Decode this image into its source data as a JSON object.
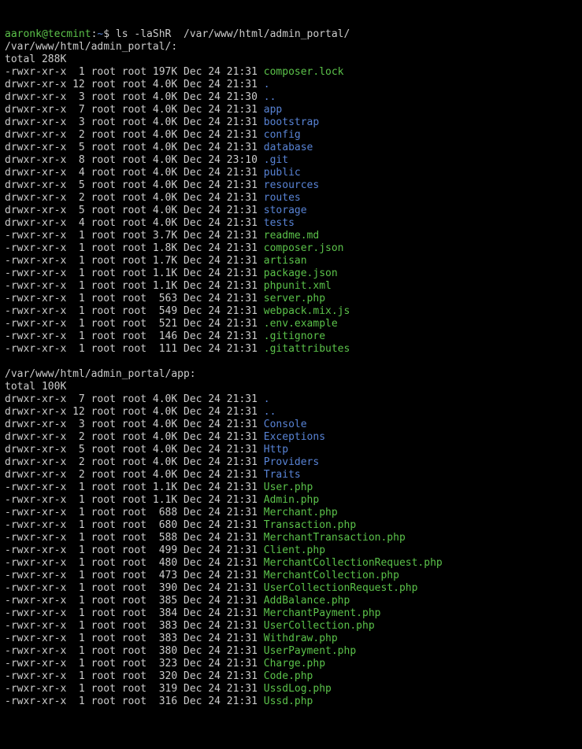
{
  "prompt": {
    "user": "aaronk",
    "host": "tecmint",
    "path": "~",
    "symbol": "$",
    "command": "ls -laShR  /var/www/html/admin_portal/"
  },
  "sections": [
    {
      "header": "/var/www/html/admin_portal/:",
      "total": "total 288K",
      "rows": [
        {
          "perm": "-rwxr-xr-x",
          "links": " 1",
          "owner": "root",
          "group": "root",
          "size": "197K",
          "date": "Dec 24 21:31",
          "name": "composer.lock",
          "cls": "file-exec"
        },
        {
          "perm": "drwxr-xr-x",
          "links": "12",
          "owner": "root",
          "group": "root",
          "size": "4.0K",
          "date": "Dec 24 21:31",
          "name": ".",
          "cls": "file-dir"
        },
        {
          "perm": "drwxr-xr-x",
          "links": " 3",
          "owner": "root",
          "group": "root",
          "size": "4.0K",
          "date": "Dec 24 21:30",
          "name": "..",
          "cls": "file-dir"
        },
        {
          "perm": "drwxr-xr-x",
          "links": " 7",
          "owner": "root",
          "group": "root",
          "size": "4.0K",
          "date": "Dec 24 21:31",
          "name": "app",
          "cls": "file-dir"
        },
        {
          "perm": "drwxr-xr-x",
          "links": " 3",
          "owner": "root",
          "group": "root",
          "size": "4.0K",
          "date": "Dec 24 21:31",
          "name": "bootstrap",
          "cls": "file-dir"
        },
        {
          "perm": "drwxr-xr-x",
          "links": " 2",
          "owner": "root",
          "group": "root",
          "size": "4.0K",
          "date": "Dec 24 21:31",
          "name": "config",
          "cls": "file-dir"
        },
        {
          "perm": "drwxr-xr-x",
          "links": " 5",
          "owner": "root",
          "group": "root",
          "size": "4.0K",
          "date": "Dec 24 21:31",
          "name": "database",
          "cls": "file-dir"
        },
        {
          "perm": "drwxr-xr-x",
          "links": " 8",
          "owner": "root",
          "group": "root",
          "size": "4.0K",
          "date": "Dec 24 23:10",
          "name": ".git",
          "cls": "file-dir"
        },
        {
          "perm": "drwxr-xr-x",
          "links": " 4",
          "owner": "root",
          "group": "root",
          "size": "4.0K",
          "date": "Dec 24 21:31",
          "name": "public",
          "cls": "file-dir"
        },
        {
          "perm": "drwxr-xr-x",
          "links": " 5",
          "owner": "root",
          "group": "root",
          "size": "4.0K",
          "date": "Dec 24 21:31",
          "name": "resources",
          "cls": "file-dir"
        },
        {
          "perm": "drwxr-xr-x",
          "links": " 2",
          "owner": "root",
          "group": "root",
          "size": "4.0K",
          "date": "Dec 24 21:31",
          "name": "routes",
          "cls": "file-dir"
        },
        {
          "perm": "drwxr-xr-x",
          "links": " 5",
          "owner": "root",
          "group": "root",
          "size": "4.0K",
          "date": "Dec 24 21:31",
          "name": "storage",
          "cls": "file-dir"
        },
        {
          "perm": "drwxr-xr-x",
          "links": " 4",
          "owner": "root",
          "group": "root",
          "size": "4.0K",
          "date": "Dec 24 21:31",
          "name": "tests",
          "cls": "file-dir"
        },
        {
          "perm": "-rwxr-xr-x",
          "links": " 1",
          "owner": "root",
          "group": "root",
          "size": "3.7K",
          "date": "Dec 24 21:31",
          "name": "readme.md",
          "cls": "file-exec"
        },
        {
          "perm": "-rwxr-xr-x",
          "links": " 1",
          "owner": "root",
          "group": "root",
          "size": "1.8K",
          "date": "Dec 24 21:31",
          "name": "composer.json",
          "cls": "file-exec"
        },
        {
          "perm": "-rwxr-xr-x",
          "links": " 1",
          "owner": "root",
          "group": "root",
          "size": "1.7K",
          "date": "Dec 24 21:31",
          "name": "artisan",
          "cls": "file-exec"
        },
        {
          "perm": "-rwxr-xr-x",
          "links": " 1",
          "owner": "root",
          "group": "root",
          "size": "1.1K",
          "date": "Dec 24 21:31",
          "name": "package.json",
          "cls": "file-exec"
        },
        {
          "perm": "-rwxr-xr-x",
          "links": " 1",
          "owner": "root",
          "group": "root",
          "size": "1.1K",
          "date": "Dec 24 21:31",
          "name": "phpunit.xml",
          "cls": "file-exec"
        },
        {
          "perm": "-rwxr-xr-x",
          "links": " 1",
          "owner": "root",
          "group": "root",
          "size": " 563",
          "date": "Dec 24 21:31",
          "name": "server.php",
          "cls": "file-exec"
        },
        {
          "perm": "-rwxr-xr-x",
          "links": " 1",
          "owner": "root",
          "group": "root",
          "size": " 549",
          "date": "Dec 24 21:31",
          "name": "webpack.mix.js",
          "cls": "file-exec"
        },
        {
          "perm": "-rwxr-xr-x",
          "links": " 1",
          "owner": "root",
          "group": "root",
          "size": " 521",
          "date": "Dec 24 21:31",
          "name": ".env.example",
          "cls": "file-exec"
        },
        {
          "perm": "-rwxr-xr-x",
          "links": " 1",
          "owner": "root",
          "group": "root",
          "size": " 146",
          "date": "Dec 24 21:31",
          "name": ".gitignore",
          "cls": "file-exec"
        },
        {
          "perm": "-rwxr-xr-x",
          "links": " 1",
          "owner": "root",
          "group": "root",
          "size": " 111",
          "date": "Dec 24 21:31",
          "name": ".gitattributes",
          "cls": "file-exec"
        }
      ]
    },
    {
      "header": "/var/www/html/admin_portal/app:",
      "total": "total 100K",
      "rows": [
        {
          "perm": "drwxr-xr-x",
          "links": " 7",
          "owner": "root",
          "group": "root",
          "size": "4.0K",
          "date": "Dec 24 21:31",
          "name": ".",
          "cls": "file-dir"
        },
        {
          "perm": "drwxr-xr-x",
          "links": "12",
          "owner": "root",
          "group": "root",
          "size": "4.0K",
          "date": "Dec 24 21:31",
          "name": "..",
          "cls": "file-dir"
        },
        {
          "perm": "drwxr-xr-x",
          "links": " 3",
          "owner": "root",
          "group": "root",
          "size": "4.0K",
          "date": "Dec 24 21:31",
          "name": "Console",
          "cls": "file-dir"
        },
        {
          "perm": "drwxr-xr-x",
          "links": " 2",
          "owner": "root",
          "group": "root",
          "size": "4.0K",
          "date": "Dec 24 21:31",
          "name": "Exceptions",
          "cls": "file-dir"
        },
        {
          "perm": "drwxr-xr-x",
          "links": " 5",
          "owner": "root",
          "group": "root",
          "size": "4.0K",
          "date": "Dec 24 21:31",
          "name": "Http",
          "cls": "file-dir"
        },
        {
          "perm": "drwxr-xr-x",
          "links": " 2",
          "owner": "root",
          "group": "root",
          "size": "4.0K",
          "date": "Dec 24 21:31",
          "name": "Providers",
          "cls": "file-dir"
        },
        {
          "perm": "drwxr-xr-x",
          "links": " 2",
          "owner": "root",
          "group": "root",
          "size": "4.0K",
          "date": "Dec 24 21:31",
          "name": "Traits",
          "cls": "file-dir"
        },
        {
          "perm": "-rwxr-xr-x",
          "links": " 1",
          "owner": "root",
          "group": "root",
          "size": "1.1K",
          "date": "Dec 24 21:31",
          "name": "User.php",
          "cls": "file-exec"
        },
        {
          "perm": "-rwxr-xr-x",
          "links": " 1",
          "owner": "root",
          "group": "root",
          "size": "1.1K",
          "date": "Dec 24 21:31",
          "name": "Admin.php",
          "cls": "file-exec"
        },
        {
          "perm": "-rwxr-xr-x",
          "links": " 1",
          "owner": "root",
          "group": "root",
          "size": " 688",
          "date": "Dec 24 21:31",
          "name": "Merchant.php",
          "cls": "file-exec"
        },
        {
          "perm": "-rwxr-xr-x",
          "links": " 1",
          "owner": "root",
          "group": "root",
          "size": " 680",
          "date": "Dec 24 21:31",
          "name": "Transaction.php",
          "cls": "file-exec"
        },
        {
          "perm": "-rwxr-xr-x",
          "links": " 1",
          "owner": "root",
          "group": "root",
          "size": " 588",
          "date": "Dec 24 21:31",
          "name": "MerchantTransaction.php",
          "cls": "file-exec"
        },
        {
          "perm": "-rwxr-xr-x",
          "links": " 1",
          "owner": "root",
          "group": "root",
          "size": " 499",
          "date": "Dec 24 21:31",
          "name": "Client.php",
          "cls": "file-exec"
        },
        {
          "perm": "-rwxr-xr-x",
          "links": " 1",
          "owner": "root",
          "group": "root",
          "size": " 480",
          "date": "Dec 24 21:31",
          "name": "MerchantCollectionRequest.php",
          "cls": "file-exec"
        },
        {
          "perm": "-rwxr-xr-x",
          "links": " 1",
          "owner": "root",
          "group": "root",
          "size": " 473",
          "date": "Dec 24 21:31",
          "name": "MerchantCollection.php",
          "cls": "file-exec"
        },
        {
          "perm": "-rwxr-xr-x",
          "links": " 1",
          "owner": "root",
          "group": "root",
          "size": " 390",
          "date": "Dec 24 21:31",
          "name": "UserCollectionRequest.php",
          "cls": "file-exec"
        },
        {
          "perm": "-rwxr-xr-x",
          "links": " 1",
          "owner": "root",
          "group": "root",
          "size": " 385",
          "date": "Dec 24 21:31",
          "name": "AddBalance.php",
          "cls": "file-exec"
        },
        {
          "perm": "-rwxr-xr-x",
          "links": " 1",
          "owner": "root",
          "group": "root",
          "size": " 384",
          "date": "Dec 24 21:31",
          "name": "MerchantPayment.php",
          "cls": "file-exec"
        },
        {
          "perm": "-rwxr-xr-x",
          "links": " 1",
          "owner": "root",
          "group": "root",
          "size": " 383",
          "date": "Dec 24 21:31",
          "name": "UserCollection.php",
          "cls": "file-exec"
        },
        {
          "perm": "-rwxr-xr-x",
          "links": " 1",
          "owner": "root",
          "group": "root",
          "size": " 383",
          "date": "Dec 24 21:31",
          "name": "Withdraw.php",
          "cls": "file-exec"
        },
        {
          "perm": "-rwxr-xr-x",
          "links": " 1",
          "owner": "root",
          "group": "root",
          "size": " 380",
          "date": "Dec 24 21:31",
          "name": "UserPayment.php",
          "cls": "file-exec"
        },
        {
          "perm": "-rwxr-xr-x",
          "links": " 1",
          "owner": "root",
          "group": "root",
          "size": " 323",
          "date": "Dec 24 21:31",
          "name": "Charge.php",
          "cls": "file-exec"
        },
        {
          "perm": "-rwxr-xr-x",
          "links": " 1",
          "owner": "root",
          "group": "root",
          "size": " 320",
          "date": "Dec 24 21:31",
          "name": "Code.php",
          "cls": "file-exec"
        },
        {
          "perm": "-rwxr-xr-x",
          "links": " 1",
          "owner": "root",
          "group": "root",
          "size": " 319",
          "date": "Dec 24 21:31",
          "name": "UssdLog.php",
          "cls": "file-exec"
        },
        {
          "perm": "-rwxr-xr-x",
          "links": " 1",
          "owner": "root",
          "group": "root",
          "size": " 316",
          "date": "Dec 24 21:31",
          "name": "Ussd.php",
          "cls": "file-exec"
        }
      ]
    }
  ]
}
